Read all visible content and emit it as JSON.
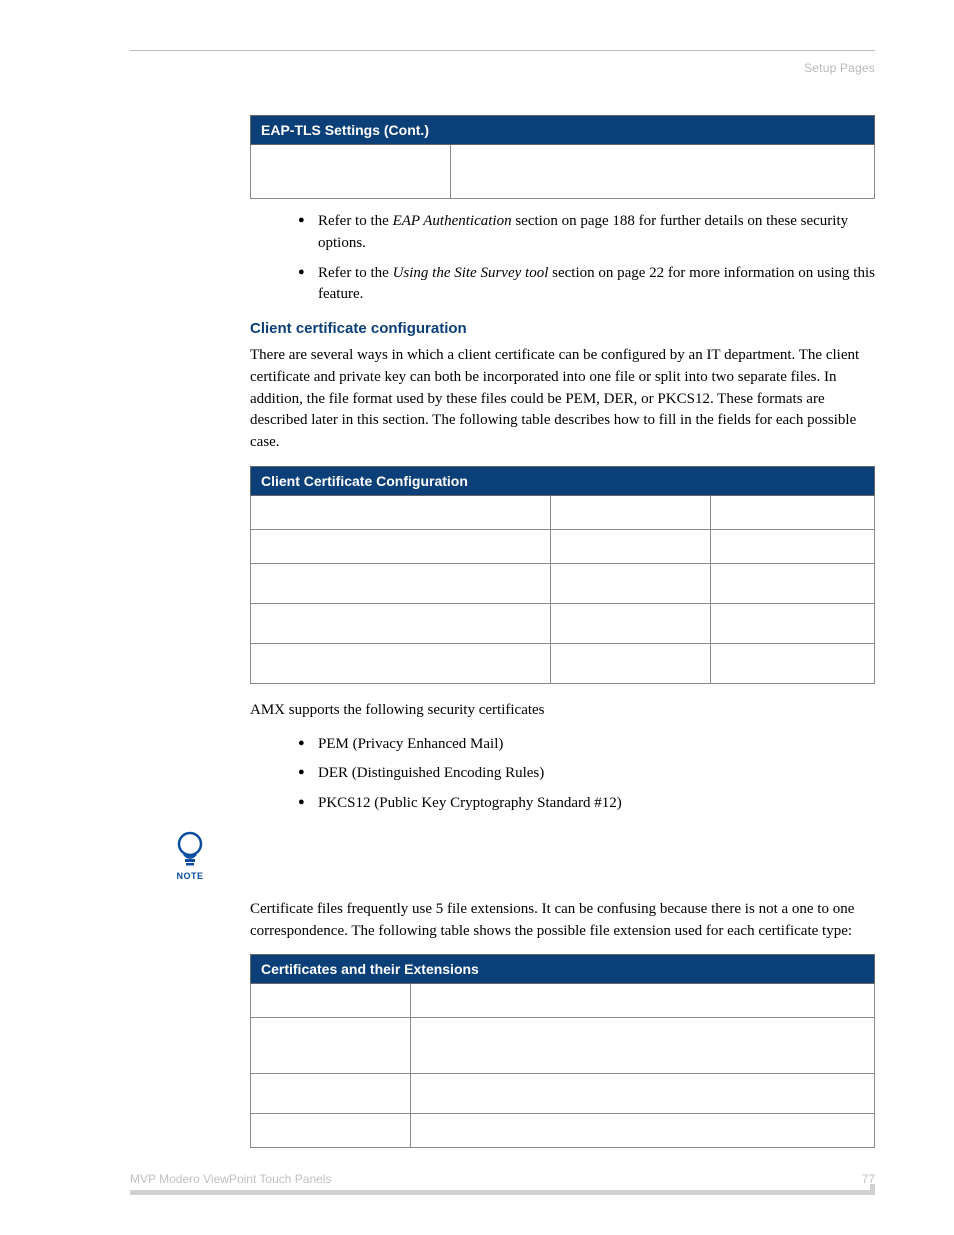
{
  "header": {
    "right": "Setup Pages"
  },
  "eap": {
    "title": "EAP-TLS Settings (Cont.)"
  },
  "refs": {
    "r1_a": "Refer to the ",
    "r1_i": "EAP Authentication",
    "r1_b": " section on page 188 for further details on these security options.",
    "r2_a": "Refer to the ",
    "r2_i": "Using the Site Survey tool",
    "r2_b": " section on page 22 for more information on using this feature."
  },
  "ccc": {
    "heading": "Client certificate configuration",
    "para": "There are several ways in which a client certificate can be configured by an IT department. The client certificate and private key can both be incorporated into one file or split into two separate files. In addition, the file format used by these files could be PEM, DER, or PKCS12. These formats are described later in this section. The following table describes how to fill in the fields for each possible case.",
    "table_title": "Client Certificate Configuration"
  },
  "amx": {
    "line": "AMX supports the following security certificates",
    "b1": "PEM (Privacy Enhanced Mail)",
    "b2": "DER (Distinguished Encoding Rules)",
    "b3": "PKCS12 (Public Key Cryptography Standard #12)"
  },
  "note": {
    "label": "NOTE"
  },
  "certext": {
    "para": "Certificate files frequently use 5 file extensions. It can be confusing because there is not a one to one correspondence. The following table shows the possible file extension used for each certificate type:",
    "title": "Certificates and their Extensions"
  },
  "footer": {
    "left": "MVP Modero ViewPoint Touch Panels",
    "page": "77"
  }
}
